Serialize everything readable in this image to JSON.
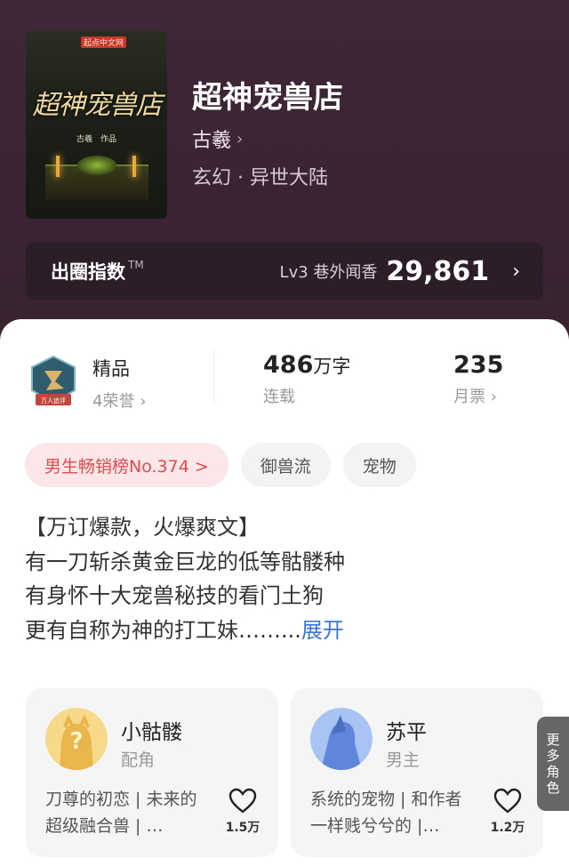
{
  "book": {
    "cover_publisher": "起点中文网",
    "cover_title": "超神宠兽店",
    "cover_author": "古羲　作品",
    "title": "超神宠兽店",
    "author": "古羲",
    "genre": "玄幻 · 异世大陆"
  },
  "quan": {
    "label": "出圈指数",
    "tm": "TM",
    "level": "Lv3 巷外闻香",
    "value": "29,861"
  },
  "stats": {
    "quality_title": "精品",
    "honors": "4荣誉",
    "badge_text": "万人追评",
    "words_num": "486",
    "words_unit": "万字",
    "status": "连载",
    "tickets": "235",
    "tickets_label": "月票"
  },
  "tags": [
    "男生畅销榜No.374 >",
    "御兽流",
    "宠物"
  ],
  "intro": {
    "lines": [
      "【万订爆款，火爆爽文】",
      "有一刀斩杀黄金巨龙的低等骷髅种",
      "有身怀十大宠兽秘技的看门土狗",
      "更有自称为神的打工妹……..."
    ],
    "expand": "展开"
  },
  "roles": [
    {
      "name": "小骷髅",
      "role": "配角",
      "desc": "刀尊的初恋 | 未来的超级融合兽 | …",
      "likes": "1.5万"
    },
    {
      "name": "苏平",
      "role": "男主",
      "desc": "系统的宠物 | 和作者一样贱兮兮的 |…",
      "likes": "1.2万"
    }
  ],
  "more_roles": [
    "更",
    "多",
    "角",
    "色"
  ],
  "colors": {
    "accent": "#e24b4f",
    "link": "#3b73d9",
    "hero_bg": "#3a2636"
  }
}
